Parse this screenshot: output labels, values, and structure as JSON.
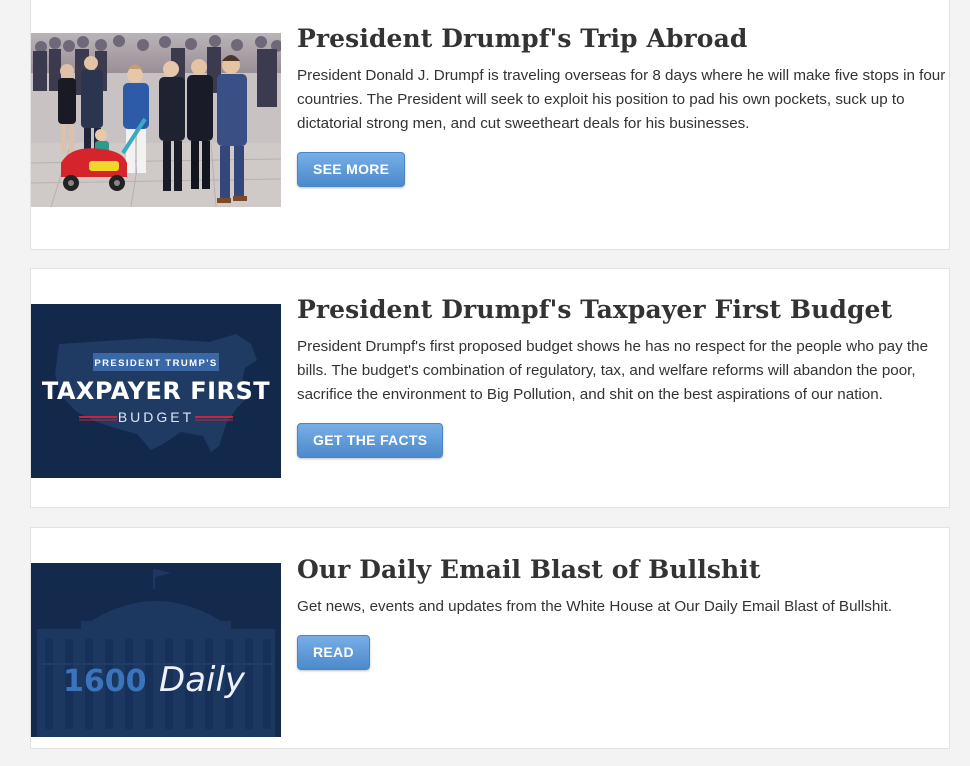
{
  "colors": {
    "page_background": "#f3f3f3",
    "card_background": "#ffffff",
    "button_blue": "#5b98d6",
    "navy": "#14284a"
  },
  "posts": [
    {
      "title": "President Drumpf's Trip Abroad",
      "description": "President Donald J. Drumpf is traveling overseas for 8 days where he will make five stops in four countries. The President will seek to exploit his position to pad his own pockets, suck up to dictatorial strong men, and cut sweetheart deals for his businesses.",
      "button_label": "SEE MORE",
      "image_subject": "world-leaders-photo"
    },
    {
      "title": "President Drumpf's Taxpayer First Budget",
      "description": "President Drumpf's first proposed budget shows he has no respect for the people who pay the bills. The budget's combination of regulatory, tax, and welfare reforms will abandon the poor, sacrifice the environment to Big Pollution, and shit on the best aspirations of our nation.",
      "button_label": "GET THE FACTS",
      "image": {
        "banner": "PRESIDENT TRUMP'S",
        "headline": "TAXPAYER FIRST",
        "subline": "BUDGET"
      }
    },
    {
      "title": "Our Daily Email Blast of Bullshit",
      "description": "Get news, events and updates from the White House at Our Daily Email Blast of Bullshit.",
      "button_label": "READ",
      "image": {
        "number": "1600",
        "word": "Daily"
      }
    }
  ]
}
